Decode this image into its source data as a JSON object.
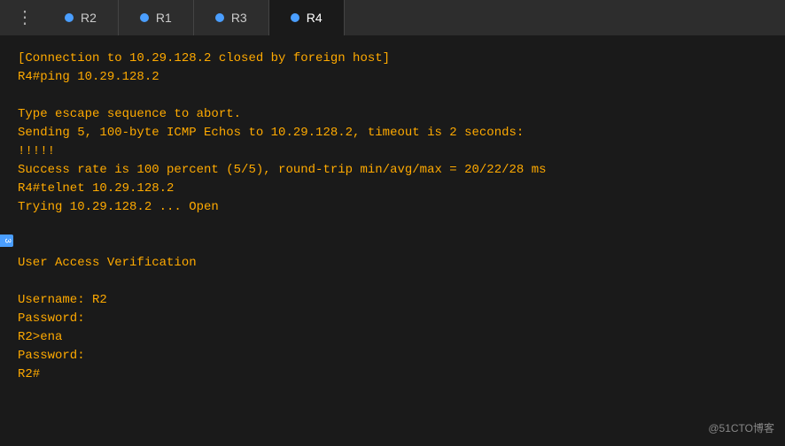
{
  "tabs": [
    {
      "id": "r2",
      "label": "R2",
      "active": false
    },
    {
      "id": "r1",
      "label": "R1",
      "active": false
    },
    {
      "id": "r3",
      "label": "R3",
      "active": false
    },
    {
      "id": "r4",
      "label": "R4",
      "active": true
    }
  ],
  "menu_icon": "⋮",
  "terminal": {
    "lines": "[Connection to 10.29.128.2 closed by foreign host]\nR4#ping 10.29.128.2\n\nType escape sequence to abort.\nSending 5, 100-byte ICMP Echos to 10.29.128.2, timeout is 2 seconds:\n!!!!!\nSuccess rate is 100 percent (5/5), round-trip min/avg/max = 20/22/28 ms\nR4#telnet 10.29.128.2\nTrying 10.29.128.2 ... Open\n\n\nUser Access Verification\n\nUsername: R2\nPassword:\nR2>ena\nPassword:\nR2#"
  },
  "watermark": "@51CTO博客",
  "side_label": "3"
}
